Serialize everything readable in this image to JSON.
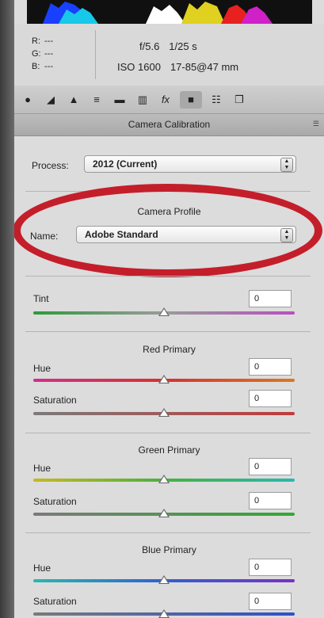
{
  "info": {
    "r_label": "R:",
    "r_value": "---",
    "g_label": "G:",
    "g_value": "---",
    "b_label": "B:",
    "b_value": "---",
    "aperture": "f/5.6",
    "shutter": "1/25 s",
    "iso": "ISO 1600",
    "lens": "17-85@47 mm"
  },
  "toolbar": {
    "icons": [
      "basic-icon",
      "tone-curve-icon",
      "detail-icon",
      "hsl-icon",
      "split-toning-icon",
      "lens-corrections-icon",
      "effects-icon",
      "camera-calibration-icon",
      "presets-icon",
      "snapshots-icon"
    ],
    "active": "camera-calibration-icon"
  },
  "panel": {
    "title": "Camera Calibration"
  },
  "process": {
    "label": "Process:",
    "value": "2012 (Current)"
  },
  "profile": {
    "heading": "Camera Profile",
    "name_label": "Name:",
    "name_value": "Adobe Standard"
  },
  "shadows": {
    "tint_label": "Tint",
    "tint_value": 0
  },
  "red": {
    "heading": "Red Primary",
    "hue_label": "Hue",
    "hue_value": 0,
    "sat_label": "Saturation",
    "sat_value": 0
  },
  "green": {
    "heading": "Green Primary",
    "hue_label": "Hue",
    "hue_value": 0,
    "sat_label": "Saturation",
    "sat_value": 0
  },
  "blue": {
    "heading": "Blue Primary",
    "hue_label": "Hue",
    "hue_value": 0,
    "sat_label": "Saturation",
    "sat_value": 0
  },
  "colors": {
    "highlight_ellipse": "#c41e2b"
  }
}
